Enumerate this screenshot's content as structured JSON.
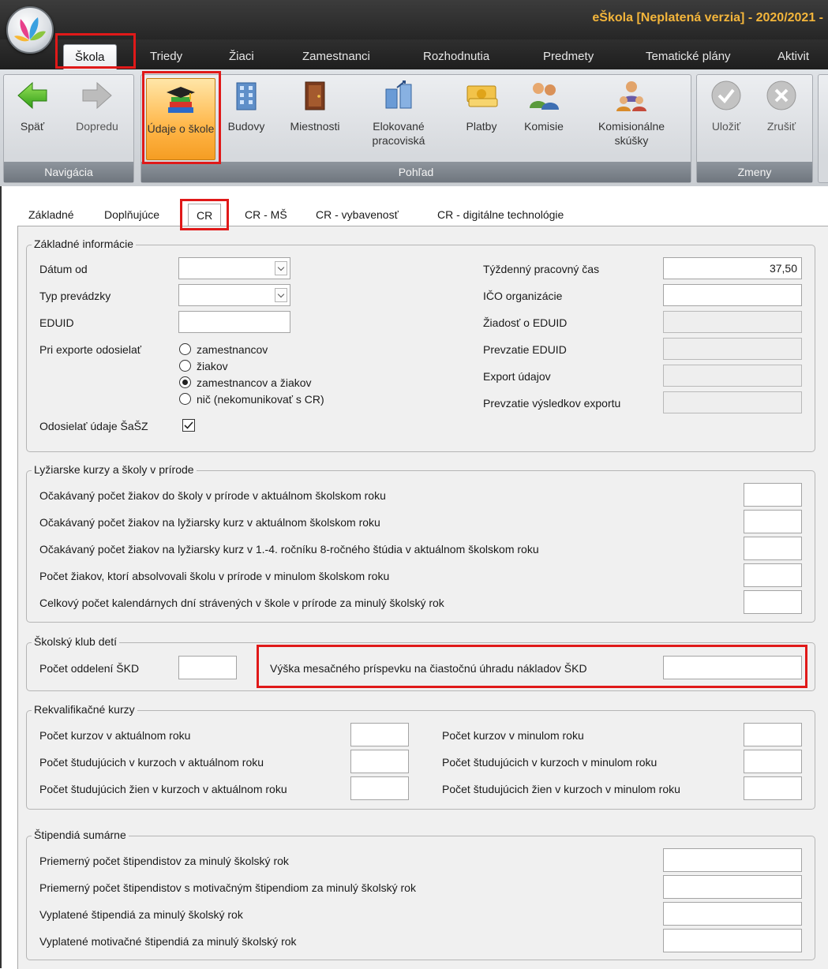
{
  "window": {
    "title": "eŠkola [Neplatená verzia] - 2020/2021 -"
  },
  "menu": {
    "tabs": [
      {
        "label": "Škola"
      },
      {
        "label": "Triedy"
      },
      {
        "label": "Žiaci"
      },
      {
        "label": "Zamestnanci"
      },
      {
        "label": "Rozhodnutia"
      },
      {
        "label": "Predmety"
      },
      {
        "label": "Tematické plány"
      },
      {
        "label": "Aktivit"
      }
    ]
  },
  "ribbon": {
    "groups": {
      "navigation": "Navigácia",
      "view": "Pohľad",
      "changes": "Zmeny"
    },
    "buttons": {
      "back": "Späť",
      "forward": "Dopredu",
      "school_info": "Údaje o škole",
      "buildings": "Budovy",
      "rooms": "Miestnosti",
      "detached": "Elokované pracoviská",
      "payments": "Platby",
      "commissions": "Komisie",
      "commission_exams": "Komisionálne skúšky",
      "save": "Uložiť",
      "cancel": "Zrušiť"
    }
  },
  "tabs": [
    {
      "label": "Základné"
    },
    {
      "label": "Doplňujúce"
    },
    {
      "label": "CR"
    },
    {
      "label": "CR - MŠ"
    },
    {
      "label": "CR - vybavenosť"
    },
    {
      "label": "CR - digitálne technológie"
    }
  ],
  "basic": {
    "legend": "Základné informácie",
    "date_from": {
      "label": "Dátum od",
      "value": ""
    },
    "operation_type": {
      "label": "Typ prevádzky",
      "value": ""
    },
    "eduid": {
      "label": "EDUID",
      "value": ""
    },
    "export_send": {
      "label": "Pri exporte odosielať",
      "options": [
        "zamestnancov",
        "žiakov",
        "zamestnancov a žiakov",
        "nič (nekomunikovať s CR)"
      ],
      "selected": "zamestnancov a žiakov"
    },
    "sassz": {
      "label": "Odosielať údaje ŠaŠZ",
      "checked": true
    },
    "weekly_hours": {
      "label": "Týždenný pracovný čas",
      "value": "37,50"
    },
    "ico": {
      "label": "IČO organizácie",
      "value": ""
    },
    "eduid_request": {
      "label": "Žiadosť o EDUID",
      "value": ""
    },
    "eduid_take": {
      "label": "Prevzatie EDUID",
      "value": ""
    },
    "export_data": {
      "label": "Export údajov",
      "value": ""
    },
    "export_results": {
      "label": "Prevzatie výsledkov exportu",
      "value": ""
    }
  },
  "ski": {
    "legend": "Lyžiarske kurzy a školy v prírode",
    "rows": [
      {
        "label": "Očakávaný počet žiakov do školy v prírode v aktuálnom školskom roku",
        "value": ""
      },
      {
        "label": "Očakávaný počet žiakov na lyžiarsky kurz v aktuálnom školskom roku",
        "value": ""
      },
      {
        "label": "Očakávaný počet žiakov na lyžiarsky kurz v 1.-4. ročníku 8-ročného štúdia v aktuálnom školskom roku",
        "value": ""
      },
      {
        "label": "Počet žiakov, ktorí absolvovali školu v prírode v minulom školskom roku",
        "value": ""
      },
      {
        "label": "Celkový počet kalendárnych dní strávených v škole v prírode za minulý školský rok",
        "value": ""
      }
    ]
  },
  "club": {
    "legend": "Školský klub detí",
    "departments": {
      "label": "Počet oddelení ŠKD",
      "value": ""
    },
    "fee": {
      "label": "Výška mesačného príspevku na čiastočnú úhradu nákladov ŠKD",
      "value": ""
    }
  },
  "requal": {
    "legend": "Rekvalifikačné kurzy",
    "left": [
      {
        "label": "Počet kurzov v aktuálnom roku",
        "value": ""
      },
      {
        "label": "Počet študujúcich v kurzoch v aktuálnom roku",
        "value": ""
      },
      {
        "label": "Počet študujúcich žien v kurzoch v aktuálnom roku",
        "value": ""
      }
    ],
    "right": [
      {
        "label": "Počet kurzov v minulom roku",
        "value": ""
      },
      {
        "label": "Počet študujúcich v kurzoch v minulom roku",
        "value": ""
      },
      {
        "label": "Počet študujúcich žien v kurzoch v minulom roku",
        "value": ""
      }
    ]
  },
  "scholar": {
    "legend": "Štipendiá sumárne",
    "rows": [
      {
        "label": "Priemerný počet štipendistov za minulý školský rok",
        "value": ""
      },
      {
        "label": "Priemerný počet štipendistov s motivačným štipendiom za minulý školský rok",
        "value": ""
      },
      {
        "label": "Vyplatené štipendiá za minulý školský rok",
        "value": ""
      },
      {
        "label": "Vyplatené motivačné štipendiá za minulý školský rok",
        "value": ""
      }
    ]
  }
}
